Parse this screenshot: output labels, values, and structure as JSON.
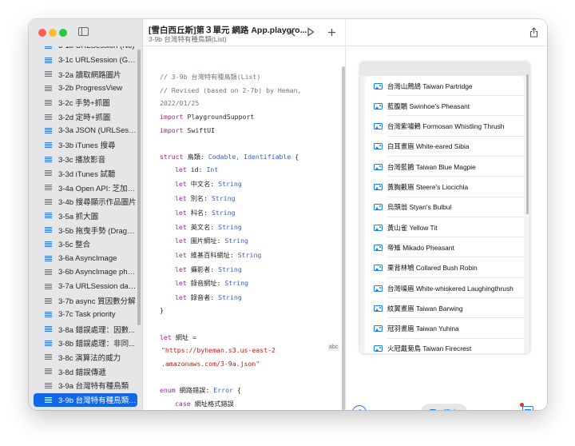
{
  "toolbar": {
    "title": "[雪白西丘斯]第３單元 網路 App.playgro...",
    "subtitle": "3-9b 台灣特有種鳥類(List)",
    "prev_icon": "chevron-left-icon",
    "next_icon": "play-icon",
    "add_icon": "plus-icon",
    "share_icon": "share-icon"
  },
  "sidebar": {
    "items": [
      {
        "label": "3-1b URLSession (No)"
      },
      {
        "label": "3-1c URLSession (Good)"
      },
      {
        "label": "3-2a 讀取網路圖片"
      },
      {
        "label": "3-2b ProgressView"
      },
      {
        "label": "3-2c 手勢+抓圖"
      },
      {
        "label": "3-2d 定時+抓圖"
      },
      {
        "label": "3-3a JSON (URLSessio..."
      },
      {
        "label": "3-3b iTunes 搜尋"
      },
      {
        "label": "3-3c 播放影音"
      },
      {
        "label": "3-3d iTunes 試聽"
      },
      {
        "label": "3-4a Open API: 芝加哥..."
      },
      {
        "label": "3-4b 搜尋顯示作品圖片"
      },
      {
        "label": "3-5a 抓大圖"
      },
      {
        "label": "3-5b 拖曳手勢 (DragGe..."
      },
      {
        "label": "3-5c 整合"
      },
      {
        "label": "3-6a AsyncImage"
      },
      {
        "label": "3-6b AsyncImage phase"
      },
      {
        "label": "3-7a URLSession data()"
      },
      {
        "label": "3-7b async 質因數分解"
      },
      {
        "label": "3-7c Task priority"
      },
      {
        "label": "3-8a 錯誤處理：因數..."
      },
      {
        "label": "3-8b 錯誤處理：非同..."
      },
      {
        "label": "3-8c 演算法的威力"
      },
      {
        "label": "3-8d 錯誤傳遞"
      },
      {
        "label": "3-9a 台灣特有種鳥類"
      },
      {
        "label": "3-9b 台灣特有種鳥類(..."
      }
    ],
    "selected_index": 25
  },
  "code": {
    "comment1": "// 3-9b 台灣特有種鳥類(List)",
    "comment2": "// Revised (based on 2-7b) by Heman,",
    "comment3": " 2022/01/25",
    "import_kw": "import",
    "import1": "PlaygroundSupport",
    "import2": "SwiftUI",
    "struct_kw": "struct",
    "struct_name": "鳥類:",
    "protocol1": "Codable,",
    "protocol2": "Identifiable",
    "brace_open": "{",
    "let_kw": "let",
    "field_id": "id:",
    "field_id_type": "Int",
    "field_cn": "中文名:",
    "field_alias": "別名:",
    "field_family": "科名:",
    "field_en": "英文名:",
    "field_img": "圖片網址:",
    "field_wiki": "維基百科網址:",
    "field_photographer": "攝影者:",
    "field_audio": "錄音網址:",
    "field_recorder": "錄音者:",
    "string_type": "String",
    "brace_close": "}",
    "url_decl": "網址 =",
    "url_part1": "\"https://byheman.s3.us-east-2",
    "url_part2": ".amazonaws.com/3-9a.json\"",
    "abc_badge": "abc",
    "enum_kw": "enum",
    "enum_name": "網路錯誤:",
    "enum_type": "Error",
    "case_kw": "case",
    "case_name": "網址格式錯誤"
  },
  "birds": [
    {
      "label": "台灣山鷓鴣 Taiwan Partridge"
    },
    {
      "label": "藍腹鷴 Swinhoe's Pheasant"
    },
    {
      "label": "台灣紫嘯鶇 Formosan Whistling Thrush"
    },
    {
      "label": "白耳畫眉 White-eared Sibia"
    },
    {
      "label": "台灣藍鵲 Taiwan Blue Magpie"
    },
    {
      "label": "黃胸藪眉 Steere's Liocichla"
    },
    {
      "label": "烏頭翁 Styan's Bulbul"
    },
    {
      "label": "黃山雀 Yellow Tit"
    },
    {
      "label": "帝雉 Mikado Pheasant"
    },
    {
      "label": "栗背林鴝 Collared Bush Robin"
    },
    {
      "label": "台灣噪眉 White-whiskered Laughingthrush"
    },
    {
      "label": "紋翼畫眉 Taiwan Barwing"
    },
    {
      "label": "冠羽畫眉 Taiwan Yuhina"
    },
    {
      "label": "火冠戴菊鳥 Taiwan Firecrest"
    }
  ],
  "live": {
    "stop_label": "停止"
  },
  "colors": {
    "accent": "#1268e3",
    "link_blue": "#1a7cf5",
    "keyword": "#9b2393",
    "type": "#3b5dc9",
    "string": "#c41a16",
    "comment": "#6e7781"
  }
}
